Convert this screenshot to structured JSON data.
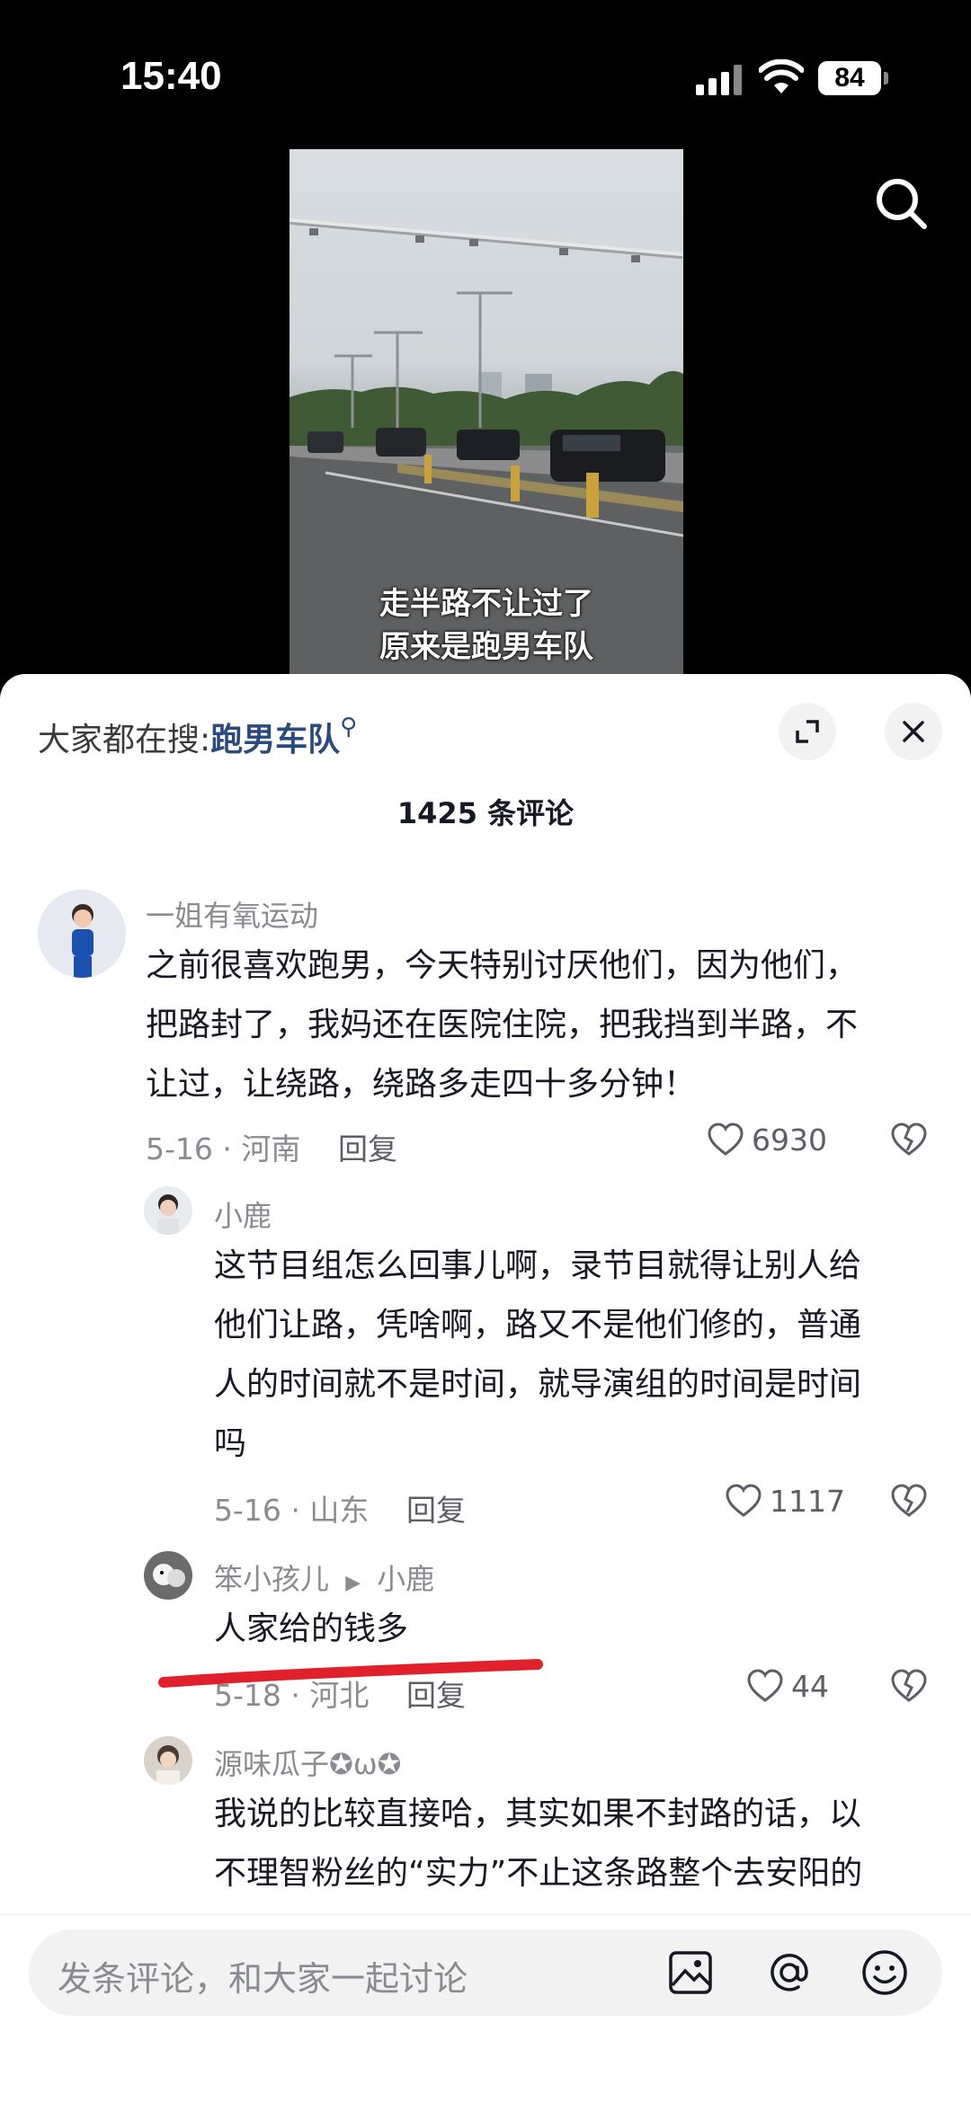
{
  "status": {
    "time": "15:40",
    "battery": "84"
  },
  "video": {
    "caption_line1": "走半路不让过了",
    "caption_line2": "原来是跑男车队"
  },
  "sheet": {
    "hot_search_prefix": "大家都在搜:",
    "hot_search_term": "跑男车队",
    "comment_count": "1425 条评论"
  },
  "comments": [
    {
      "username": "一姐有氧运动",
      "lines": [
        "之前很喜欢跑男，今天特别讨厌他们，因为他们，",
        "把路封了，我妈还在医院住院，把我挡到半路，不",
        "让过，让绕路，绕路多走四十多分钟！"
      ],
      "meta": "5-16 · 河南",
      "reply": "回复",
      "likes": "6930"
    },
    {
      "username": "小鹿",
      "lines": [
        "这节目组怎么回事儿啊，录节目就得让别人给",
        "他们让路，凭啥啊，路又不是他们修的，普通",
        "人的时间就不是时间，就导演组的时间是时间",
        "吗"
      ],
      "meta": "5-16 · 山东",
      "reply": "回复",
      "likes": "1117"
    },
    {
      "username": "笨小孩儿",
      "reply_to": "小鹿",
      "lines": [
        "人家给的钱多"
      ],
      "meta": "5-18 · 河北",
      "reply": "回复",
      "likes": "44"
    },
    {
      "username": "源味瓜子✪ω✪",
      "lines": [
        "我说的比较直接哈，其实如果不封路的话，以",
        "不理智粉丝的“实力”不止这条路整个去安阳的"
      ]
    }
  ],
  "input": {
    "placeholder": "发条评论，和大家一起讨论"
  },
  "colors": {
    "accent_link": "#2b4a7d",
    "highlight_stroke": "#e0202a"
  }
}
